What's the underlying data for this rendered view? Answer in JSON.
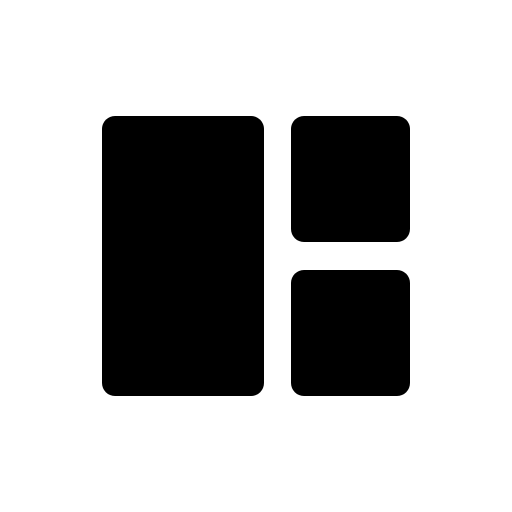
{
  "icon": {
    "name": "layout-columns-icon",
    "color": "#000000",
    "background": "#ffffff"
  }
}
